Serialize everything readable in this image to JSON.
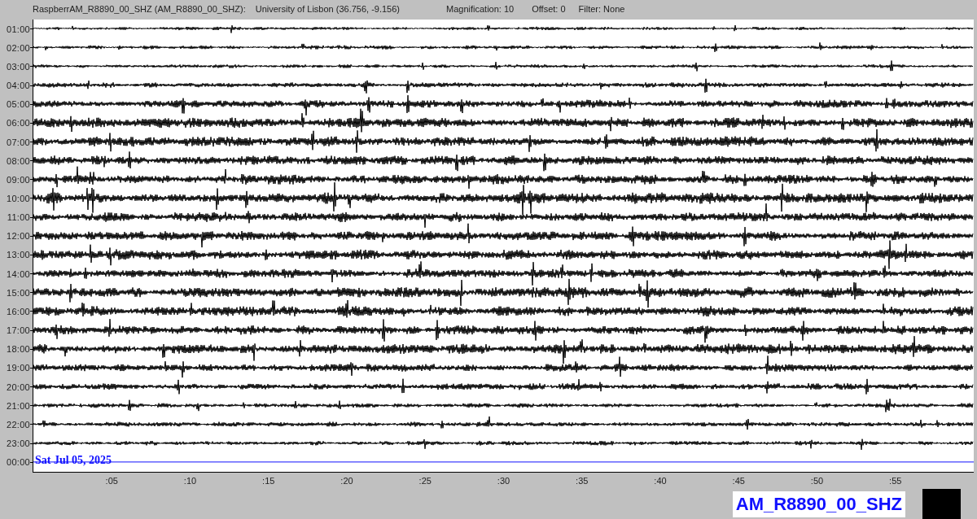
{
  "header": {
    "station": "RaspberrAM_R8890_00_SHZ (AM_R8890_00_SHZ):",
    "location": "University of Lisbon (36.756, -9.156)",
    "magnification": "Magnification: 10",
    "offset": "Offset: 0",
    "filter": "Filter: None"
  },
  "helicorder": {
    "rows": [
      {
        "time": "01:00",
        "kind": "trace"
      },
      {
        "time": "02:00",
        "kind": "trace"
      },
      {
        "time": "03:00",
        "kind": "trace"
      },
      {
        "time": "04:00",
        "kind": "trace"
      },
      {
        "time": "05:00",
        "kind": "trace"
      },
      {
        "time": "06:00",
        "kind": "trace"
      },
      {
        "time": "07:00",
        "kind": "trace"
      },
      {
        "time": "08:00",
        "kind": "trace"
      },
      {
        "time": "09:00",
        "kind": "trace"
      },
      {
        "time": "10:00",
        "kind": "trace"
      },
      {
        "time": "11:00",
        "kind": "trace"
      },
      {
        "time": "12:00",
        "kind": "trace"
      },
      {
        "time": "13:00",
        "kind": "trace"
      },
      {
        "time": "14:00",
        "kind": "trace"
      },
      {
        "time": "15:00",
        "kind": "trace"
      },
      {
        "time": "16:00",
        "kind": "trace"
      },
      {
        "time": "17:00",
        "kind": "trace"
      },
      {
        "time": "18:00",
        "kind": "trace"
      },
      {
        "time": "19:00",
        "kind": "trace"
      },
      {
        "time": "20:00",
        "kind": "trace"
      },
      {
        "time": "21:00",
        "kind": "trace"
      },
      {
        "time": "22:00",
        "kind": "trace"
      },
      {
        "time": "23:00",
        "kind": "trace"
      },
      {
        "time": "00:00",
        "kind": "current"
      }
    ],
    "date": "Sat Jul 05, 2025",
    "x_ticks": [
      ":05",
      ":10",
      ":15",
      ":20",
      ":25",
      ":30",
      ":35",
      ":40",
      ":45",
      ":50",
      ":55"
    ]
  },
  "footer": {
    "channel": "AM_R8890_00_SHZ"
  }
}
